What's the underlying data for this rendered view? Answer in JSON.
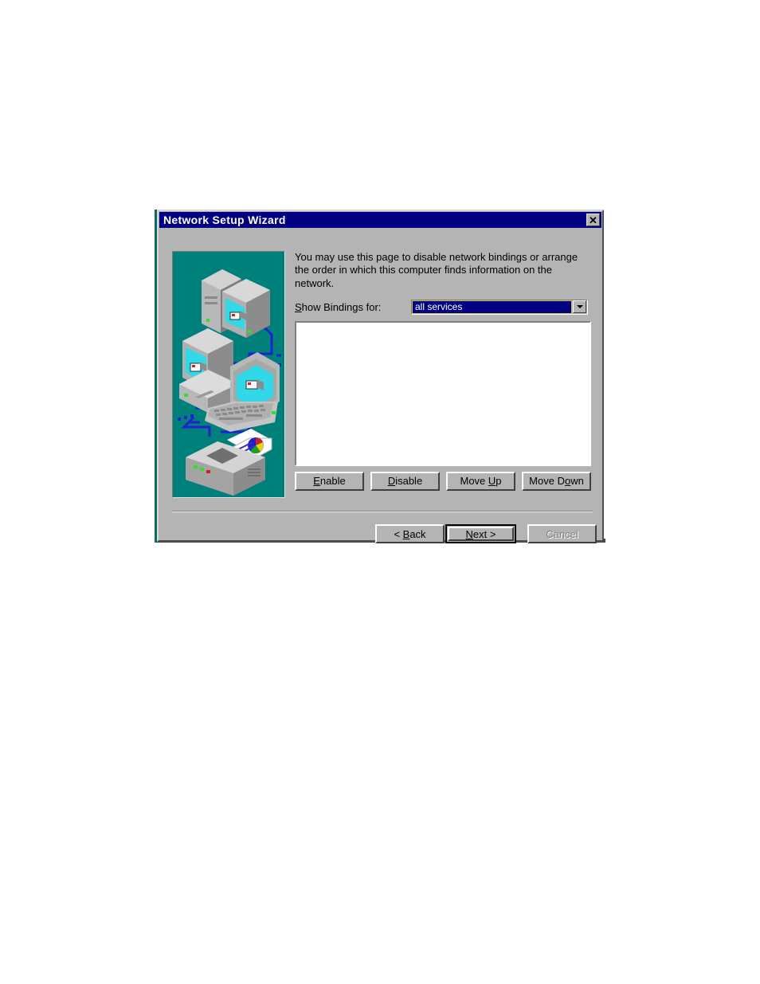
{
  "window": {
    "title": "Network Setup Wizard",
    "close_icon": "close-icon",
    "close_label": "✕"
  },
  "content": {
    "description": "You may use this page to disable network bindings or arrange the order in which this computer finds information on the network.",
    "bindings_label_pre": "S",
    "bindings_label_post": "how Bindings for:",
    "combo": {
      "value": "all services",
      "arrow_icon": "chevron-down-icon",
      "options": [
        "all services"
      ]
    },
    "listbox": {
      "items": []
    }
  },
  "action_buttons": [
    {
      "mnemonic": "E",
      "rest": "nable",
      "name": "enable-button",
      "disabled": false
    },
    {
      "mnemonic": "D",
      "rest": "isable",
      "name": "disable-button",
      "disabled": false
    },
    {
      "pre": "Move ",
      "mnemonic": "U",
      "rest": "p",
      "name": "move-up-button",
      "disabled": false
    },
    {
      "pre": "Move D",
      "mnemonic": "o",
      "rest": "wn",
      "name": "move-down-button",
      "disabled": false
    }
  ],
  "nav_buttons": {
    "back": {
      "pre": "< ",
      "mnemonic": "B",
      "rest": "ack"
    },
    "next": {
      "mnemonic": "N",
      "rest": "ext >"
    },
    "cancel": {
      "label": "Cancel",
      "disabled": true
    }
  },
  "sidebar": {
    "graphic_name": "network-devices-illustration",
    "background_color": "#00807a",
    "devices": [
      "server-tower",
      "crt-monitor",
      "desktop-pc",
      "laptop",
      "color-printer"
    ],
    "cable_color": "#2020d0",
    "screen_color": "#30d8e8"
  },
  "colors": {
    "titlebar": "#000080",
    "dialog_face": "#b4b4b4",
    "selection": "#000080",
    "selection_text": "#ffffff",
    "focus_outline": "#d4d400"
  }
}
